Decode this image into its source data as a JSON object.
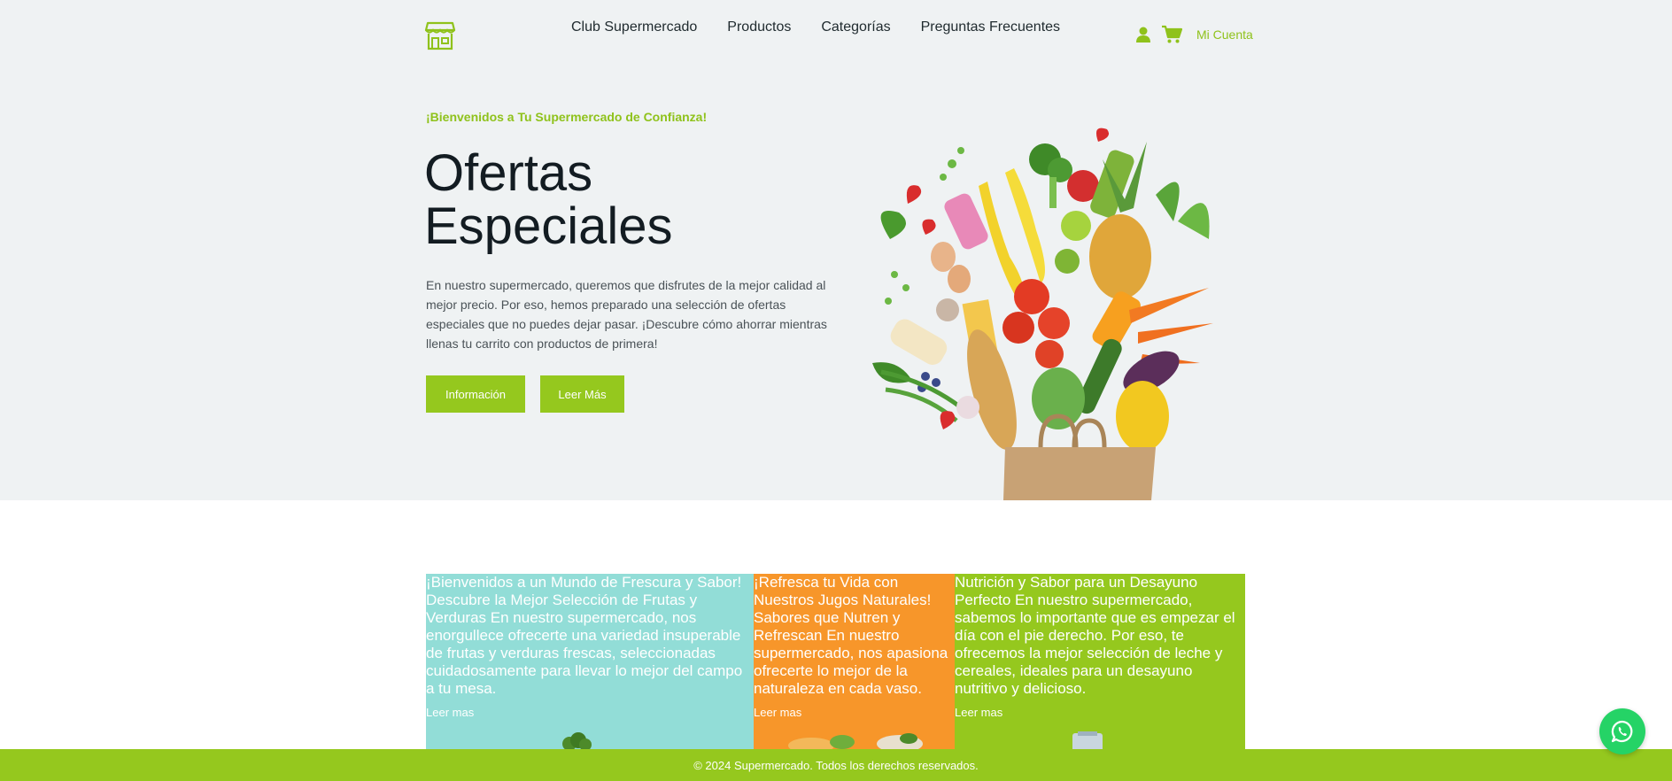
{
  "header": {
    "logo_icon": "store-icon",
    "nav": [
      "Club Supermercado",
      "Productos",
      "Categorías",
      "Preguntas Frecuentes"
    ],
    "user_icon": "user-icon",
    "cart_icon": "cart-icon",
    "account_label": "Mi Cuenta"
  },
  "hero": {
    "welcome": "¡Bienvenidos a Tu Supermercado de Confianza!",
    "title_line1": "Ofertas",
    "title_line2": "Especiales",
    "description": "En nuestro supermercado, queremos que disfrutes de la mejor calidad al mejor precio. Por eso, hemos preparado una selección de ofertas especiales que no puedes dejar pasar. ¡Descubre cómo ahorrar mientras llenas tu carrito con productos de primera!",
    "btn_info": "Información",
    "btn_more": "Leer Más",
    "image": "grocery-bag-produce-image"
  },
  "cards": [
    {
      "text": "¡Bienvenidos a un Mundo de Frescura y Sabor! Descubre la Mejor Selección de Frutas y Verduras En nuestro supermercado, nos enorgullece ofrecerte una variedad insuperable de frutas y verduras frescas, seleccionadas cuidadosamente para llevar lo mejor del campo a tu mesa.",
      "link": "Leer mas"
    },
    {
      "text": "¡Refresca tu Vida con Nuestros Jugos Naturales! Sabores que Nutren y Refrescan En nuestro supermercado, nos apasiona ofrecerte lo mejor de la naturaleza en cada vaso.",
      "link": "Leer mas"
    },
    {
      "text": "Nutrición y Sabor para un Desayuno Perfecto En nuestro supermercado, sabemos lo importante que es empezar el día con el pie derecho. Por eso, te ofrecemos la mejor selección de leche y cereales, ideales para un desayuno nutritivo y delicioso.",
      "link": "Leer mas"
    }
  ],
  "footer": {
    "copyright": "© 2024 Supermercado. Todos los derechos reservados."
  },
  "whatsapp_icon": "whatsapp-icon",
  "colors": {
    "accent": "#95c81e",
    "card_teal": "#92ddd7",
    "card_orange": "#f7962a",
    "hero_bg": "#eff2f3"
  }
}
